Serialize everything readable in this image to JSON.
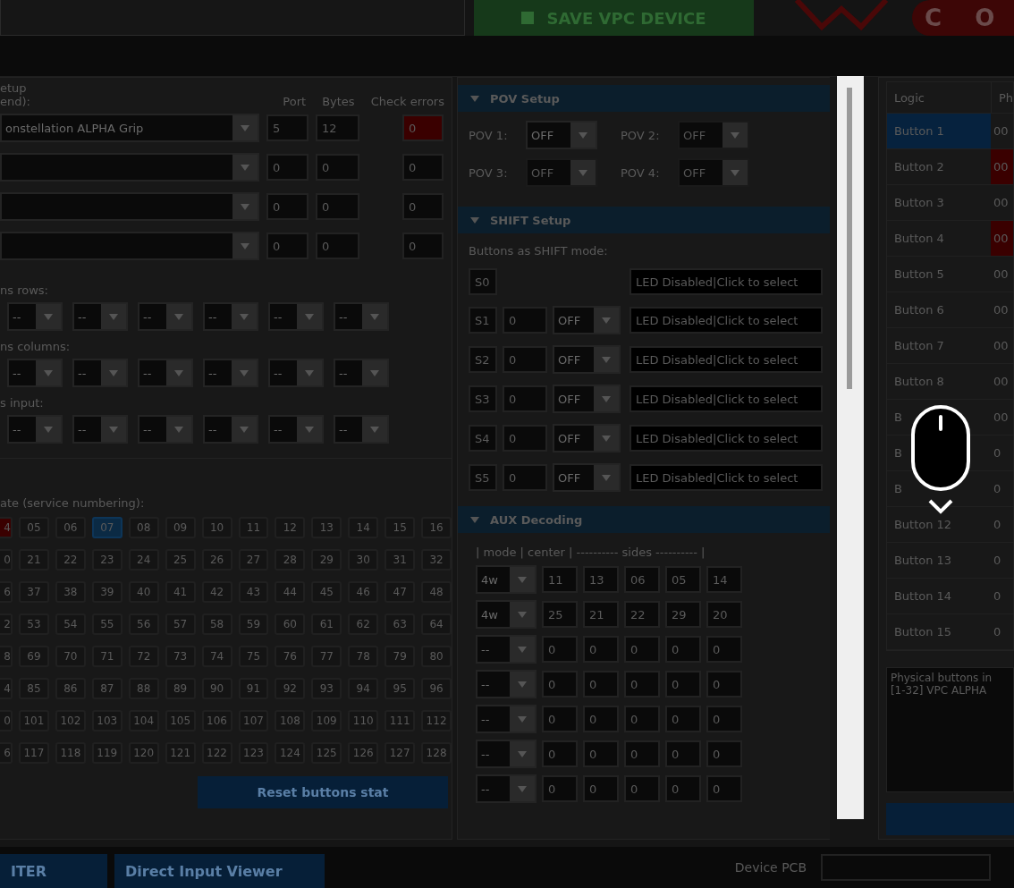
{
  "top_bar": {
    "save_button": "SAVE VPC DEVICE",
    "brand_button": "C O"
  },
  "left_panel": {
    "title": "etup",
    "subtitle": "end):",
    "columns": [
      "Port",
      "Bytes",
      "Check errors"
    ],
    "devices": [
      {
        "name": "onstellation ALPHA Grip",
        "port": "5",
        "bytes": "12",
        "check": "0",
        "error": true
      },
      {
        "port": "0",
        "bytes": "0",
        "check": "0",
        "error": false
      },
      {
        "port": "0",
        "bytes": "0",
        "check": "0",
        "error": false
      },
      {
        "port": "0",
        "bytes": "0",
        "check": "0",
        "error": false
      }
    ],
    "matrix_groups": [
      {
        "label": "ns rows:",
        "selects": [
          "--",
          "--",
          "--",
          "--",
          "--",
          "--"
        ]
      },
      {
        "label": "ns columns:",
        "selects": [
          "--",
          "--",
          "--",
          "--",
          "--",
          "--"
        ]
      },
      {
        "label": "s input:",
        "selects": [
          "--",
          "--",
          "--",
          "--",
          "--",
          "--"
        ]
      }
    ],
    "grid_label": "ate (service numbering):",
    "grid_rows": [
      [
        {
          "text": "4",
          "error": true,
          "selected": false
        },
        {
          "text": "05",
          "error": false,
          "selected": false
        },
        {
          "text": "06",
          "error": false,
          "selected": false
        },
        {
          "text": "07",
          "error": false,
          "selected": true
        },
        {
          "text": "08",
          "error": false,
          "selected": false
        },
        {
          "text": "09",
          "error": false,
          "selected": false
        },
        {
          "text": "10",
          "error": false,
          "selected": false
        },
        {
          "text": "11",
          "error": false,
          "selected": false
        },
        {
          "text": "12",
          "error": false,
          "selected": false
        },
        {
          "text": "13",
          "error": false,
          "selected": false
        },
        {
          "text": "14",
          "error": false,
          "selected": false
        },
        {
          "text": "15",
          "error": false,
          "selected": false
        },
        {
          "text": "16",
          "error": false,
          "selected": false
        }
      ],
      [
        {
          "text": "0",
          "error": false,
          "selected": false
        },
        {
          "text": "21",
          "error": false,
          "selected": false
        },
        {
          "text": "22",
          "error": false,
          "selected": false
        },
        {
          "text": "23",
          "error": false,
          "selected": false
        },
        {
          "text": "24",
          "error": false,
          "selected": false
        },
        {
          "text": "25",
          "error": false,
          "selected": false
        },
        {
          "text": "26",
          "error": false,
          "selected": false
        },
        {
          "text": "27",
          "error": false,
          "selected": false
        },
        {
          "text": "28",
          "error": false,
          "selected": false
        },
        {
          "text": "29",
          "error": false,
          "selected": false
        },
        {
          "text": "30",
          "error": false,
          "selected": false
        },
        {
          "text": "31",
          "error": false,
          "selected": false
        },
        {
          "text": "32",
          "error": false,
          "selected": false
        }
      ],
      [
        {
          "text": "6",
          "error": false,
          "selected": false
        },
        {
          "text": "37",
          "error": false,
          "selected": false
        },
        {
          "text": "38",
          "error": false,
          "selected": false
        },
        {
          "text": "39",
          "error": false,
          "selected": false
        },
        {
          "text": "40",
          "error": false,
          "selected": false
        },
        {
          "text": "41",
          "error": false,
          "selected": false
        },
        {
          "text": "42",
          "error": false,
          "selected": false
        },
        {
          "text": "43",
          "error": false,
          "selected": false
        },
        {
          "text": "44",
          "error": false,
          "selected": false
        },
        {
          "text": "45",
          "error": false,
          "selected": false
        },
        {
          "text": "46",
          "error": false,
          "selected": false
        },
        {
          "text": "47",
          "error": false,
          "selected": false
        },
        {
          "text": "48",
          "error": false,
          "selected": false
        }
      ],
      [
        {
          "text": "2",
          "error": false,
          "selected": false
        },
        {
          "text": "53",
          "error": false,
          "selected": false
        },
        {
          "text": "54",
          "error": false,
          "selected": false
        },
        {
          "text": "55",
          "error": false,
          "selected": false
        },
        {
          "text": "56",
          "error": false,
          "selected": false
        },
        {
          "text": "57",
          "error": false,
          "selected": false
        },
        {
          "text": "58",
          "error": false,
          "selected": false
        },
        {
          "text": "59",
          "error": false,
          "selected": false
        },
        {
          "text": "60",
          "error": false,
          "selected": false
        },
        {
          "text": "61",
          "error": false,
          "selected": false
        },
        {
          "text": "62",
          "error": false,
          "selected": false
        },
        {
          "text": "63",
          "error": false,
          "selected": false
        },
        {
          "text": "64",
          "error": false,
          "selected": false
        }
      ],
      [
        {
          "text": "8",
          "error": false,
          "selected": false
        },
        {
          "text": "69",
          "error": false,
          "selected": false
        },
        {
          "text": "70",
          "error": false,
          "selected": false
        },
        {
          "text": "71",
          "error": false,
          "selected": false
        },
        {
          "text": "72",
          "error": false,
          "selected": false
        },
        {
          "text": "73",
          "error": false,
          "selected": false
        },
        {
          "text": "74",
          "error": false,
          "selected": false
        },
        {
          "text": "75",
          "error": false,
          "selected": false
        },
        {
          "text": "76",
          "error": false,
          "selected": false
        },
        {
          "text": "77",
          "error": false,
          "selected": false
        },
        {
          "text": "78",
          "error": false,
          "selected": false
        },
        {
          "text": "79",
          "error": false,
          "selected": false
        },
        {
          "text": "80",
          "error": false,
          "selected": false
        }
      ],
      [
        {
          "text": "4",
          "error": false,
          "selected": false
        },
        {
          "text": "85",
          "error": false,
          "selected": false
        },
        {
          "text": "86",
          "error": false,
          "selected": false
        },
        {
          "text": "87",
          "error": false,
          "selected": false
        },
        {
          "text": "88",
          "error": false,
          "selected": false
        },
        {
          "text": "89",
          "error": false,
          "selected": false
        },
        {
          "text": "90",
          "error": false,
          "selected": false
        },
        {
          "text": "91",
          "error": false,
          "selected": false
        },
        {
          "text": "92",
          "error": false,
          "selected": false
        },
        {
          "text": "93",
          "error": false,
          "selected": false
        },
        {
          "text": "94",
          "error": false,
          "selected": false
        },
        {
          "text": "95",
          "error": false,
          "selected": false
        },
        {
          "text": "96",
          "error": false,
          "selected": false
        }
      ],
      [
        {
          "text": "0",
          "error": false,
          "selected": false
        },
        {
          "text": "101",
          "error": false,
          "selected": false
        },
        {
          "text": "102",
          "error": false,
          "selected": false
        },
        {
          "text": "103",
          "error": false,
          "selected": false
        },
        {
          "text": "104",
          "error": false,
          "selected": false
        },
        {
          "text": "105",
          "error": false,
          "selected": false
        },
        {
          "text": "106",
          "error": false,
          "selected": false
        },
        {
          "text": "107",
          "error": false,
          "selected": false
        },
        {
          "text": "108",
          "error": false,
          "selected": false
        },
        {
          "text": "109",
          "error": false,
          "selected": false
        },
        {
          "text": "110",
          "error": false,
          "selected": false
        },
        {
          "text": "111",
          "error": false,
          "selected": false
        },
        {
          "text": "112",
          "error": false,
          "selected": false
        }
      ],
      [
        {
          "text": "6",
          "error": false,
          "selected": false
        },
        {
          "text": "117",
          "error": false,
          "selected": false
        },
        {
          "text": "118",
          "error": false,
          "selected": false
        },
        {
          "text": "119",
          "error": false,
          "selected": false
        },
        {
          "text": "120",
          "error": false,
          "selected": false
        },
        {
          "text": "121",
          "error": false,
          "selected": false
        },
        {
          "text": "122",
          "error": false,
          "selected": false
        },
        {
          "text": "123",
          "error": false,
          "selected": false
        },
        {
          "text": "124",
          "error": false,
          "selected": false
        },
        {
          "text": "125",
          "error": false,
          "selected": false
        },
        {
          "text": "126",
          "error": false,
          "selected": false
        },
        {
          "text": "127",
          "error": false,
          "selected": false
        },
        {
          "text": "128",
          "error": false,
          "selected": false
        }
      ]
    ],
    "reset_button": "Reset buttons stat"
  },
  "pov_setup": {
    "title": "POV Setup",
    "items": [
      {
        "label": "POV 1:",
        "value": "OFF",
        "disabled": false
      },
      {
        "label": "POV 2:",
        "value": "OFF",
        "disabled": true
      },
      {
        "label": "POV 3:",
        "value": "OFF",
        "disabled": true
      },
      {
        "label": "POV 4:",
        "value": "OFF",
        "disabled": true
      }
    ]
  },
  "shift_setup": {
    "title": "SHIFT Setup",
    "label": "Buttons as SHIFT mode:",
    "rows": [
      {
        "id": "S0",
        "led": "LED Disabled|Click to select"
      },
      {
        "id": "S1",
        "value": "0",
        "mode": "OFF",
        "led": "LED Disabled|Click to select"
      },
      {
        "id": "S2",
        "value": "0",
        "mode": "OFF",
        "led": "LED Disabled|Click to select"
      },
      {
        "id": "S3",
        "value": "0",
        "mode": "OFF",
        "led": "LED Disabled|Click to select"
      },
      {
        "id": "S4",
        "value": "0",
        "mode": "OFF",
        "led": "LED Disabled|Click to select"
      },
      {
        "id": "S5",
        "value": "0",
        "mode": "OFF",
        "led": "LED Disabled|Click to select"
      }
    ]
  },
  "aux_decoding": {
    "title": "AUX Decoding",
    "header": "| mode | center | ---------- sides ---------- |",
    "rows": [
      {
        "mode": "4w",
        "values": [
          "11",
          "13",
          "06",
          "05",
          "14"
        ]
      },
      {
        "mode": "4w",
        "values": [
          "25",
          "21",
          "22",
          "29",
          "20"
        ]
      },
      {
        "mode": "--",
        "values": [
          "0",
          "0",
          "0",
          "0",
          "0"
        ]
      },
      {
        "mode": "--",
        "values": [
          "0",
          "0",
          "0",
          "0",
          "0"
        ]
      },
      {
        "mode": "--",
        "values": [
          "0",
          "0",
          "0",
          "0",
          "0"
        ]
      },
      {
        "mode": "--",
        "values": [
          "0",
          "0",
          "0",
          "0",
          "0"
        ]
      },
      {
        "mode": "--",
        "values": [
          "0",
          "0",
          "0",
          "0",
          "0"
        ]
      }
    ]
  },
  "logic_table": {
    "columns": [
      "Logic",
      "Ph"
    ],
    "rows": [
      {
        "name": "Button 1",
        "value": "00",
        "selected": true,
        "error": false
      },
      {
        "name": "Button 2",
        "value": "00",
        "selected": false,
        "error": true
      },
      {
        "name": "Button 3",
        "value": "00",
        "selected": false,
        "error": false
      },
      {
        "name": "Button 4",
        "value": "00",
        "selected": false,
        "error": true
      },
      {
        "name": "Button 5",
        "value": "00",
        "selected": false,
        "error": false
      },
      {
        "name": "Button 6",
        "value": "00",
        "selected": false,
        "error": false
      },
      {
        "name": "Button 7",
        "value": "00",
        "selected": false,
        "error": false
      },
      {
        "name": "Button 8",
        "value": "00",
        "selected": false,
        "error": false
      },
      {
        "name": "B",
        "value": "00",
        "selected": false,
        "error": false
      },
      {
        "name": "B",
        "value": "0",
        "selected": false,
        "error": false
      },
      {
        "name": "B",
        "value": "0",
        "selected": false,
        "error": false
      },
      {
        "name": "Button 12",
        "value": "0",
        "selected": false,
        "error": false
      },
      {
        "name": "Button 13",
        "value": "0",
        "selected": false,
        "error": false
      },
      {
        "name": "Button 14",
        "value": "0",
        "selected": false,
        "error": false
      },
      {
        "name": "Button 15",
        "value": "0",
        "selected": false,
        "error": false
      }
    ],
    "info": [
      "Physical buttons in",
      "[1-32] VPC ALPHA"
    ]
  },
  "bottom_bar": {
    "buttons": [
      "ITER",
      "Direct Input Viewer"
    ],
    "pcb_label": "Device PCB"
  }
}
